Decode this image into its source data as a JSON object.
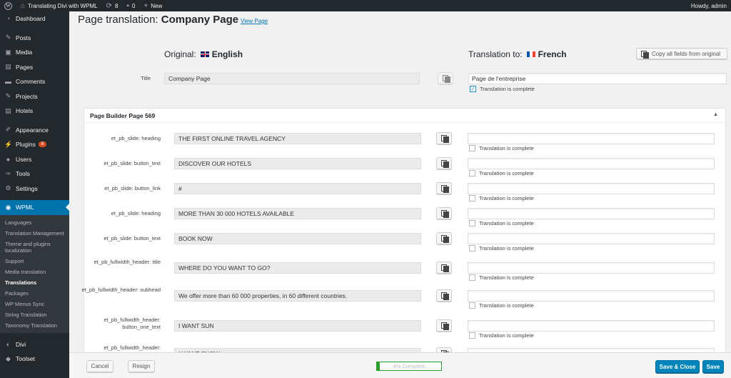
{
  "admin_bar": {
    "site_name": "Translating Divi with WPML",
    "updates": "8",
    "comments": "0",
    "new_label": "New",
    "howdy": "Howdy, admin"
  },
  "sidebar": {
    "items": [
      {
        "label": "Dashboard",
        "icon": "dashboard-icon"
      },
      {
        "label": "Posts",
        "icon": "pin-icon"
      },
      {
        "label": "Media",
        "icon": "media-icon"
      },
      {
        "label": "Pages",
        "icon": "page-icon"
      },
      {
        "label": "Comments",
        "icon": "comment-icon"
      },
      {
        "label": "Projects",
        "icon": "pin-icon"
      },
      {
        "label": "Hotels",
        "icon": "page-icon"
      },
      {
        "label": "Appearance",
        "icon": "brush-icon"
      },
      {
        "label": "Plugins",
        "icon": "plug-icon",
        "badge": "8"
      },
      {
        "label": "Users",
        "icon": "user-icon"
      },
      {
        "label": "Tools",
        "icon": "wrench-icon"
      },
      {
        "label": "Settings",
        "icon": "settings-icon"
      },
      {
        "label": "WPML",
        "icon": "wpml-icon"
      }
    ],
    "submenu": [
      "Languages",
      "Translation Management",
      "Theme and plugins localization",
      "Support",
      "Media translation",
      "Translations",
      "Packages",
      "WP Menus Sync",
      "String Translation",
      "Taxonomy Translation"
    ],
    "bottom_items": [
      {
        "label": "Divi",
        "icon": "divi-icon"
      },
      {
        "label": "Toolset",
        "icon": "toolset-icon"
      }
    ]
  },
  "header": {
    "title_prefix": "Page translation: ",
    "title_name": "Company Page",
    "view_page": "View Page"
  },
  "original": {
    "label": "Original:",
    "language": "English"
  },
  "translation": {
    "label": "Translation to:",
    "language": "French",
    "copy_all": "Copy all fields from original"
  },
  "title_field": {
    "label": "Title",
    "original": "Company Page",
    "translated": "Page de l'entreprise",
    "complete_label": "Translation is complete"
  },
  "page_builder": {
    "heading": "Page Builder Page 569",
    "complete_label": "Translation is complete",
    "rows": [
      {
        "label": "et_pb_slide: heading",
        "original": "THE FIRST ONLINE TRAVEL AGENCY",
        "translated": ""
      },
      {
        "label": "et_pb_slide: button_text",
        "original": "DISCOVER OUR HOTELS",
        "translated": ""
      },
      {
        "label": "et_pb_slide: button_link",
        "original": "#",
        "translated": ""
      },
      {
        "label": "et_pb_slide: heading",
        "original": "MORE THAN 30 000 HOTELS AVAILABLE",
        "translated": ""
      },
      {
        "label": "et_pb_slide: button_text",
        "original": "BOOK NOW",
        "translated": ""
      },
      {
        "label": "et_pb_fullwidth_header: title",
        "original": "WHERE DO YOU WANT TO GO?",
        "translated": ""
      },
      {
        "label": "et_pb_fullwidth_header: subhead",
        "original": "We offer more than 60 000 properties, in 60 different countries.",
        "translated": ""
      },
      {
        "label": "et_pb_fullwidth_header: button_one_text",
        "original": "I WANT SUN",
        "translated": ""
      },
      {
        "label": "et_pb_fullwidth_header:",
        "original": "I WANT SNOW",
        "translated": ""
      }
    ]
  },
  "footer": {
    "cancel": "Cancel",
    "resign": "Resign",
    "progress_text": "4% Complete",
    "progress_percent": 4,
    "save_close": "Save & Close",
    "save": "Save"
  },
  "colors": {
    "accent": "#0073aa",
    "progress": "#2a9d2a",
    "badge": "#d54e21"
  }
}
